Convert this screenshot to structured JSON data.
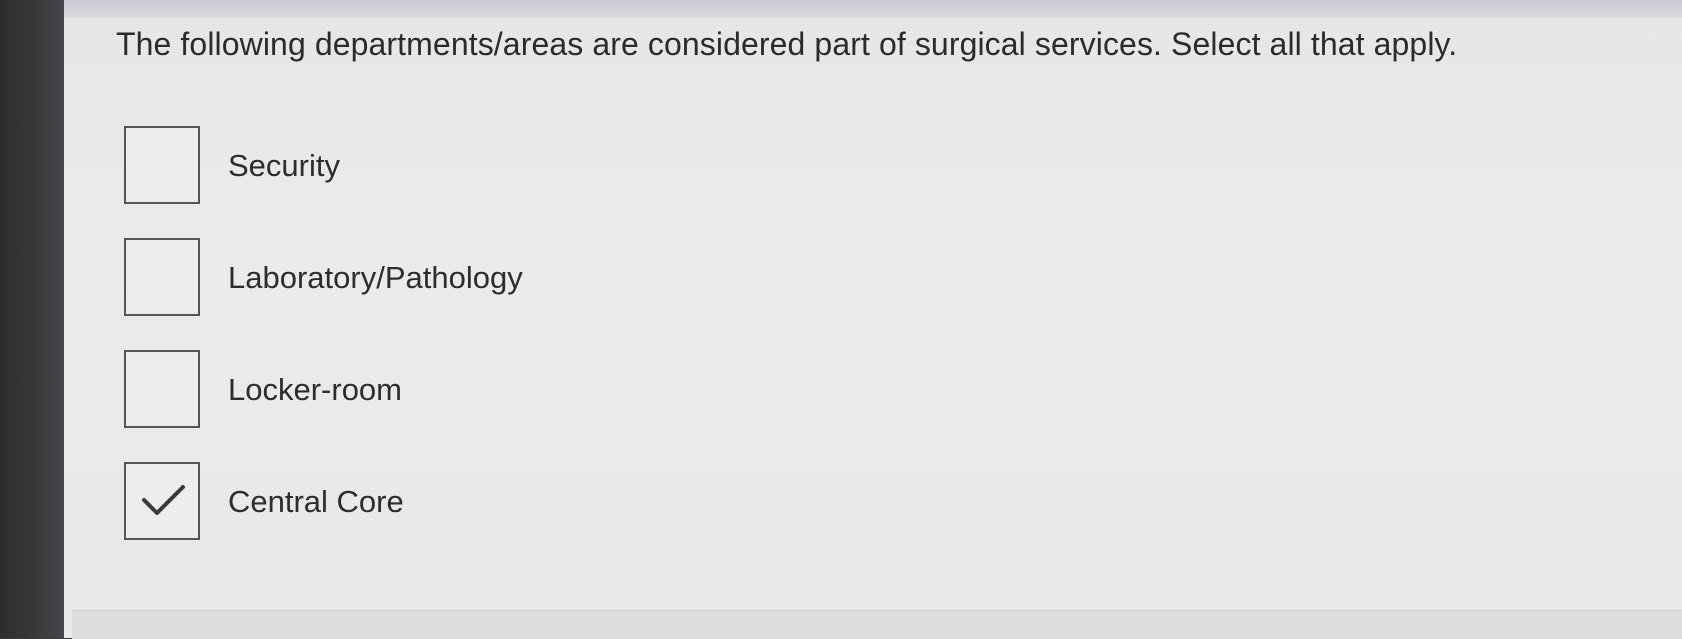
{
  "question": {
    "text": "The following departments/areas are considered part of surgical services. Select all that apply."
  },
  "options": [
    {
      "label": "Security",
      "checked": false
    },
    {
      "label": "Laboratory/Pathology",
      "checked": false
    },
    {
      "label": "Locker-room",
      "checked": false
    },
    {
      "label": "Central Core",
      "checked": true
    }
  ],
  "icons": {
    "check": "checkmark-icon"
  },
  "colors": {
    "text": "#2b2b2b",
    "checkbox_border": "#555558",
    "background": "#e9e9e8"
  }
}
